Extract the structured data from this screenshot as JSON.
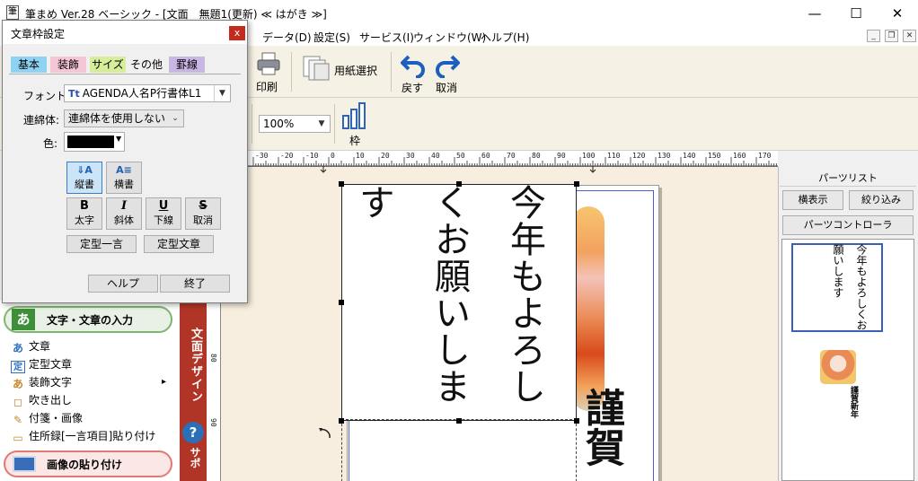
{
  "window": {
    "app_icon": "筆",
    "title": "筆まめ Ver.28 ベーシック - [文面　無題1(更新) ≪ はがき ≫]",
    "minimize": "—",
    "maximize": "☐",
    "close": "✕"
  },
  "menu": {
    "items": [
      "データ(D)",
      "設定(S)",
      "サービス(I)",
      "ウィンドウ(W)",
      "ヘルプ(H)"
    ],
    "mdi_minimize": "_",
    "mdi_restore": "❐",
    "mdi_close": "✕"
  },
  "toolbar": {
    "print": "印刷",
    "paper_select": "用紙選択",
    "undo": "戻す",
    "cancel": "取消",
    "zoom_value": "100%",
    "frame": "枠",
    "partial_label": "　"
  },
  "ruler": {
    "h_ticks": [
      "-30",
      "-20",
      "-10",
      "0",
      "10",
      "20",
      "30",
      "40",
      "50",
      "60",
      "70",
      "80",
      "90",
      "100",
      "110",
      "120",
      "130",
      "140",
      "150",
      "160",
      "170"
    ],
    "v_ticks": [
      "50",
      "60",
      "70",
      "80",
      "90"
    ]
  },
  "canvas": {
    "textbox_text": "今年もよろしくお願いします",
    "greeting": "謹賀"
  },
  "parts": {
    "title": "パーツリスト",
    "horizontal_view": "横表示",
    "filter": "絞り込み",
    "controller": "パーツコントローラ",
    "preview_text": "今年もよろしくお願いします",
    "preview_greeting": "謹賀新年"
  },
  "left_panel": {
    "input_header_icon": "あ",
    "input_header": "文字・文章の入力",
    "items": [
      {
        "icon": "あ",
        "label": "文章"
      },
      {
        "icon": "定",
        "label": "定型文章"
      },
      {
        "icon": "あ",
        "label": "装飾文字"
      },
      {
        "icon": "◻",
        "label": "吹き出し"
      },
      {
        "icon": "✎",
        "label": "付箋・画像"
      },
      {
        "icon": "▭",
        "label": "住所録[一言項目]貼り付け"
      }
    ],
    "submenu_arrow": "▸",
    "image_header": "画像の貼り付け",
    "side_tab": "文面デザイン",
    "help_icon": "?",
    "side_tab2": "サポ"
  },
  "dialog": {
    "title": "文章枠設定",
    "close": "x",
    "tabs": [
      "基本",
      "装飾",
      "サイズ",
      "その他",
      "罫線"
    ],
    "tab_colors": [
      "#8fd3f4",
      "#f5c6d6",
      "#d6ee9a",
      "#f0f0f0",
      "#c9b7e3"
    ],
    "font_label": "フォント:",
    "font_icon": "Tt",
    "font_value": "AGENDA人名P行書体L1",
    "renmen_label": "連綿体:",
    "renmen_value": "連綿体を使用しない",
    "color_label": "色:",
    "color_value": "#000000",
    "vertical": "縦書",
    "horizontal": "横書",
    "bold_icon": "B",
    "bold": "太字",
    "italic_icon": "I",
    "italic": "斜体",
    "underline_icon": "U",
    "underline": "下線",
    "strike_icon": "S",
    "strike": "取消",
    "phrase": "定型一言",
    "template": "定型文章",
    "help": "ヘルプ",
    "finish": "終了"
  }
}
